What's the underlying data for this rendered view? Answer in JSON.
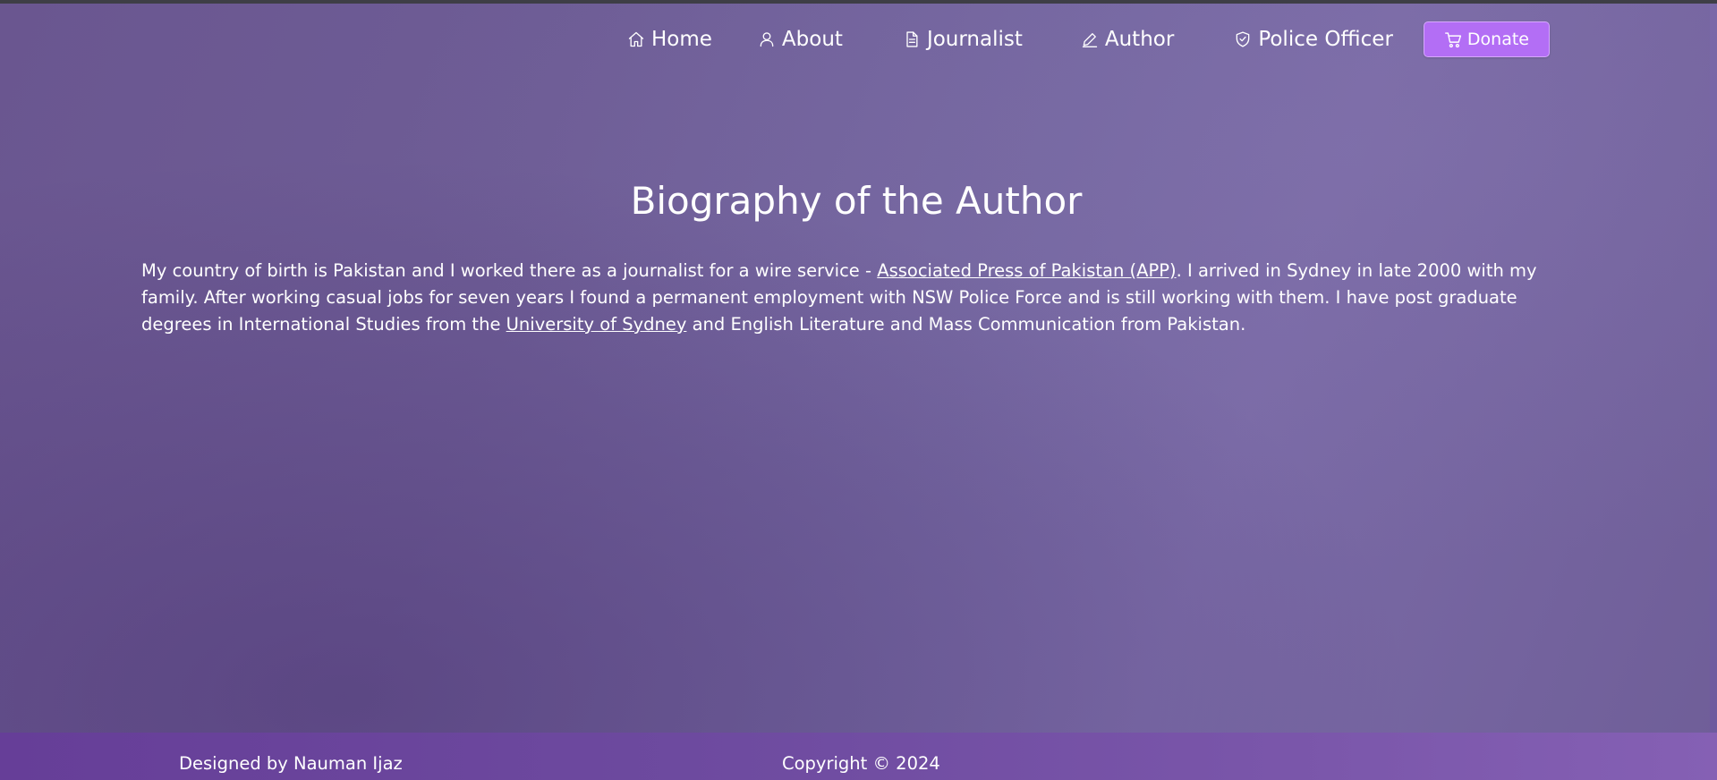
{
  "nav": {
    "items": [
      {
        "label": "Home",
        "icon": "home-icon"
      },
      {
        "label": "About",
        "icon": "person-icon"
      },
      {
        "label": "Journalist",
        "icon": "document-icon"
      },
      {
        "label": "Author",
        "icon": "pencil-icon"
      },
      {
        "label": "Police Officer",
        "icon": "shield-icon"
      }
    ],
    "donate": {
      "label": "Donate",
      "icon": "cart-icon",
      "color": "#b36ef5"
    }
  },
  "main": {
    "title": "Biography of the Author",
    "bio": {
      "part1": "My country of birth is Pakistan and I worked there as a journalist for a wire service - ",
      "link1": "Associated Press of Pakistan (APP)",
      "part2": ". I arrived in Sydney in late 2000 with my family. After working casual jobs for seven years I found a permanent employment with NSW Police Force and is still working with them. I have post graduate degrees in International Studies from the ",
      "link2": "University of Sydney",
      "part3": " and English Literature and Mass Communication from Pakistan."
    }
  },
  "footer": {
    "designed_by": "Designed by Nauman Ijaz",
    "copyright": "Copyright © 2024"
  }
}
